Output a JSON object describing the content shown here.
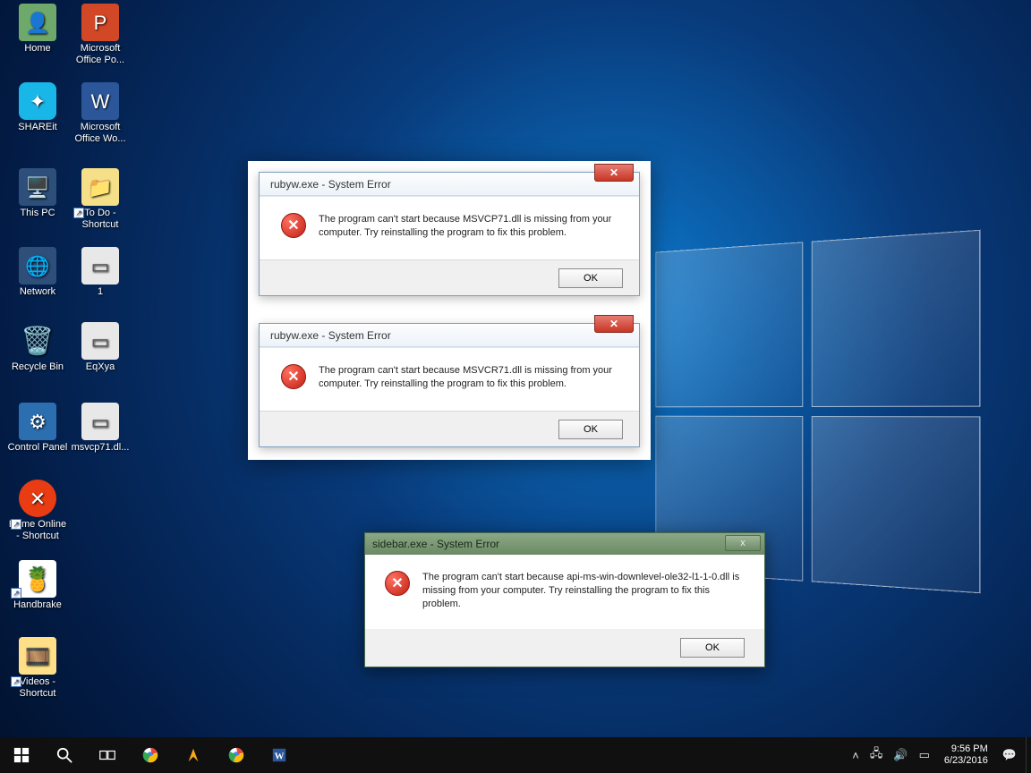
{
  "desktop_icons": {
    "home": "Home",
    "powerpoint": "Microsoft Office Po...",
    "shareit": "SHAREit",
    "word": "Microsoft Office Wo...",
    "thispc": "This PC",
    "todo": "To Do - Shortcut",
    "network": "Network",
    "one": "1",
    "recycle": "Recycle Bin",
    "eqxya": "EqXya",
    "cpanel": "Control Panel",
    "msvcp": "msvcp71.dl...",
    "homeonline": "Home Online - Shortcut",
    "handbrake": "Handbrake",
    "videos": "Videos - Shortcut"
  },
  "dialog1": {
    "title": "rubyw.exe - System Error",
    "message": "The program can't start because MSVCP71.dll is missing from your computer. Try reinstalling the program to fix this problem.",
    "ok": "OK"
  },
  "dialog2": {
    "title": "rubyw.exe - System Error",
    "message": "The program can't start because MSVCR71.dll is missing from your computer. Try reinstalling the program to fix this problem.",
    "ok": "OK"
  },
  "dialog3": {
    "title": "sidebar.exe - System Error",
    "message": "The program can't start because api-ms-win-downlevel-ole32-l1-1-0.dll is missing from your computer. Try reinstalling the program to fix this problem.",
    "ok": "OK"
  },
  "tray": {
    "time": "9:56 PM",
    "date": "6/23/2016"
  }
}
